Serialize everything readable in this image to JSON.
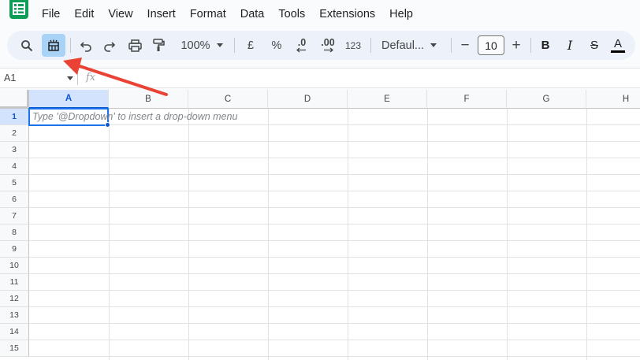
{
  "menu": {
    "items": [
      "File",
      "Edit",
      "View",
      "Insert",
      "Format",
      "Data",
      "Tools",
      "Extensions",
      "Help"
    ]
  },
  "toolbar": {
    "zoom": "100%",
    "currency": "£",
    "percent": "%",
    "decrease_decimal": ".0",
    "increase_decimal": ".00",
    "number_format": "123",
    "font_family": "Defaul...",
    "font_size": "10",
    "minus": "−",
    "plus": "+",
    "bold": "B",
    "italic": "I",
    "strikethrough": "S",
    "text_color": "A"
  },
  "formula_bar": {
    "name_box": "A1",
    "fx": "fx"
  },
  "grid": {
    "columns": [
      "A",
      "B",
      "C",
      "D",
      "E",
      "F",
      "G",
      "H"
    ],
    "rows": [
      "1",
      "2",
      "3",
      "4",
      "5",
      "6",
      "7",
      "8",
      "9",
      "10",
      "11",
      "12",
      "13",
      "14",
      "15"
    ],
    "selected_cell": "A1",
    "cell_hint": "Type '@Dropdown' to insert a drop-down menu"
  },
  "colors": {
    "accent": "#0b57d0",
    "active_button": "#a8d3f7",
    "arrow": "#ea4335",
    "toolbar_bg": "#edf2fa",
    "logo": "#0f9d58"
  }
}
